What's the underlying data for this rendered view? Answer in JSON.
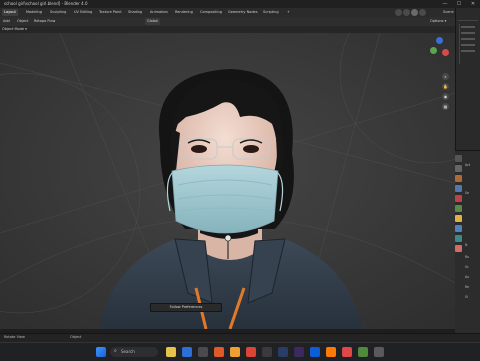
{
  "window": {
    "title": "school girl\\school girl.blend] - Blender 4.0",
    "minimize": "—",
    "maximize": "☐",
    "close": "✕"
  },
  "workspaces": [
    "Layout",
    "Modeling",
    "Sculpting",
    "UV Editing",
    "Texture Paint",
    "Shading",
    "Animation",
    "Rendering",
    "Compositing",
    "Geometry Nodes",
    "Scripting",
    "+"
  ],
  "active_workspace": "Layout",
  "scene_label": "Scene",
  "header": {
    "mode": "Add",
    "menus": [
      "Object",
      "Retopo Flow"
    ],
    "orientation": "Global",
    "options": "Options ▾"
  },
  "subbar": {
    "label": "Object Mode ▾"
  },
  "viewport": {
    "popup_label": "Follow Preferences"
  },
  "props_labels": [
    "Act",
    "Se",
    "N",
    "Ru",
    "Sc",
    "Au",
    "Re",
    "Si"
  ],
  "status": {
    "left": "Rotate View",
    "right": "Object"
  },
  "taskbar": {
    "search_placeholder": "Search"
  },
  "colors": {
    "blue": "#3b6fd8",
    "red": "#d84a4a",
    "green": "#5aa64a",
    "yellow": "#e0b040"
  }
}
